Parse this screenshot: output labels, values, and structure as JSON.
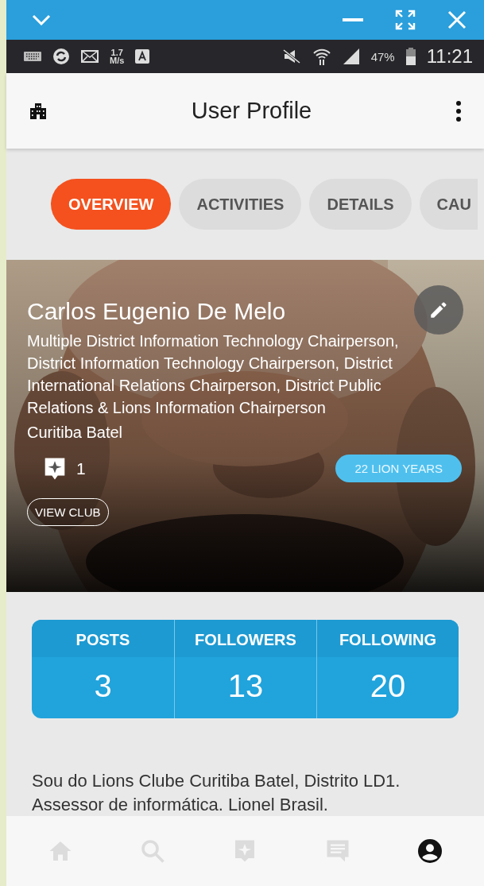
{
  "status_bar": {
    "speed": "1.7",
    "speed_unit": "M/s",
    "battery": "47%",
    "time": "11:21"
  },
  "app_bar": {
    "title": "User Profile"
  },
  "tabs": [
    {
      "label": "OVERVIEW",
      "selected": true
    },
    {
      "label": "ACTIVITIES",
      "selected": false
    },
    {
      "label": "DETAILS",
      "selected": false
    },
    {
      "label": "CAU",
      "selected": false
    }
  ],
  "profile": {
    "name": "Carlos Eugenio De Melo",
    "roles": "Multiple District Information Technology Chairperson, District Information Technology Chairperson, District International Relations Chairperson, District Public Relations & Lions Information Chairperson",
    "club": "Curitiba Batel",
    "badge_count": "1",
    "years": "22 LION YEARS",
    "view_club": "VIEW CLUB"
  },
  "stats": [
    {
      "label": "POSTS",
      "value": "3"
    },
    {
      "label": "FOLLOWERS",
      "value": "13"
    },
    {
      "label": "FOLLOWING",
      "value": "20"
    }
  ],
  "bio": "Sou do Lions Clube Curitiba Batel, Distrito LD1. Assessor de informática. Lionel Brasil.",
  "nav": [
    {
      "selected": false
    },
    {
      "selected": false
    },
    {
      "selected": false
    },
    {
      "selected": false
    },
    {
      "selected": true
    }
  ]
}
